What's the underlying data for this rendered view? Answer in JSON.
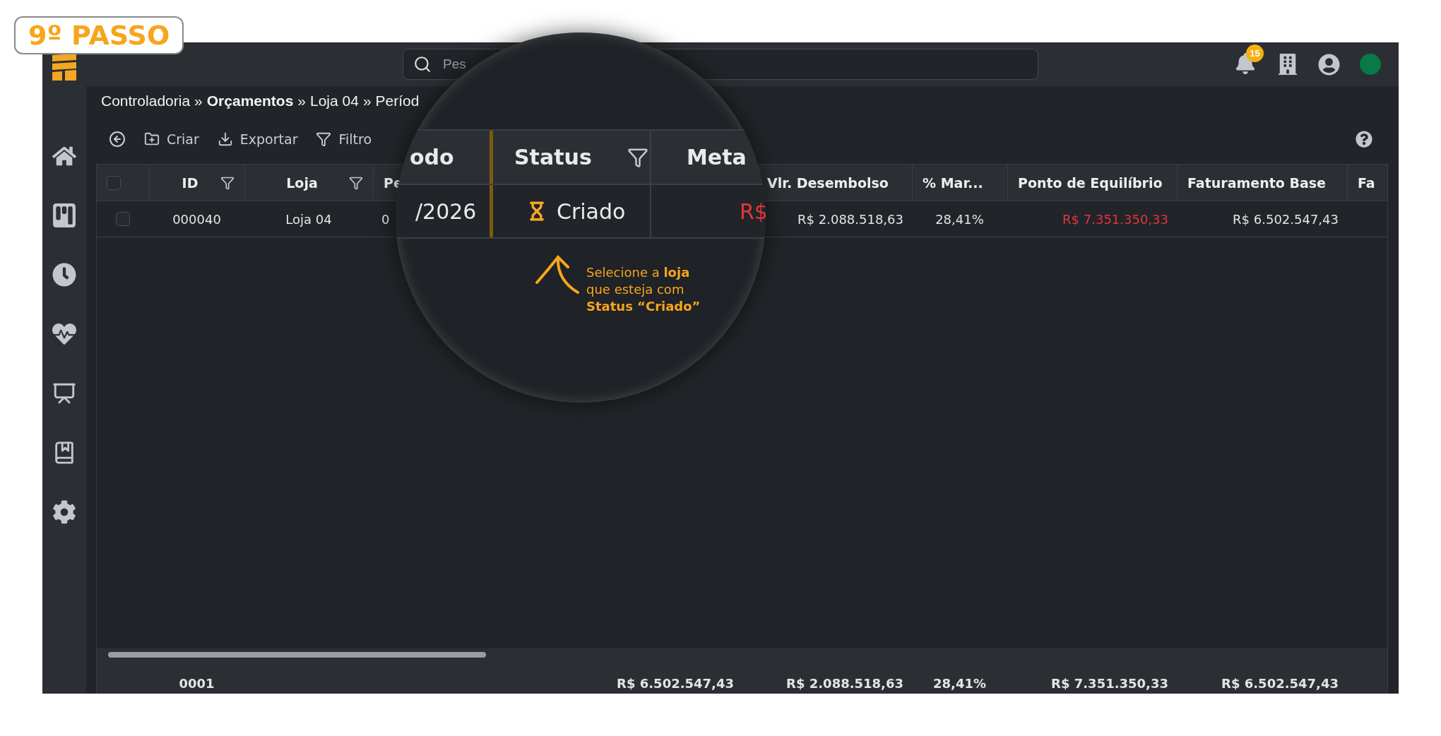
{
  "step_badge": "9º PASSO",
  "topbar": {
    "search": {
      "placeholder": "Pes"
    },
    "notifications": {
      "count": "15"
    }
  },
  "breadcrumb": {
    "separator": "»",
    "items": [
      {
        "label": "Controladoria",
        "bold": false
      },
      {
        "label": "Orçamentos",
        "bold": true
      },
      {
        "label": "Loja 04",
        "bold": false
      },
      {
        "label": "Períod",
        "bold": false
      }
    ]
  },
  "toolbar": {
    "buttons": [
      {
        "kind": "create",
        "label": "Criar"
      },
      {
        "kind": "export",
        "label": "Exportar"
      },
      {
        "kind": "filter",
        "label": "Filtro"
      }
    ]
  },
  "table": {
    "all_checked": false,
    "columns": [
      {
        "label": "ID",
        "kind": "id",
        "filter": true
      },
      {
        "label": "Loja",
        "kind": "text",
        "filter": true
      },
      {
        "label": "Pe",
        "kind": "date",
        "filter": false
      },
      {
        "label": "Vlr. Desembolso",
        "kind": "currency",
        "filter": false
      },
      {
        "label": "% Mar...",
        "kind": "percent",
        "filter": false
      },
      {
        "label": "Ponto de Equilíbrio",
        "kind": "currency",
        "filter": false
      },
      {
        "label": "Faturamento Base",
        "kind": "currency",
        "filter": false
      },
      {
        "label": "Fa",
        "filter": false
      }
    ],
    "rows": [
      {
        "checked": false,
        "cells": [
          {
            "text": "000040",
            "negative": false
          },
          {
            "text": "Loja 04",
            "negative": false
          },
          {
            "text": "0",
            "negative": false
          },
          {
            "text": "R$ 2.088.518,63",
            "negative": false
          },
          {
            "text": "28,41%",
            "negative": false
          },
          {
            "text": "R$ 7.351.350,33",
            "negative": true
          },
          {
            "text": "R$ 6.502.547,43",
            "negative": false
          }
        ]
      }
    ],
    "footer": [
      {
        "text": "0001",
        "kind": "id"
      },
      {
        "text": "R$ 6.502.547,43",
        "kind": "merged"
      },
      {
        "text": "R$ 2.088.518,63",
        "kind": "currency"
      },
      {
        "text": "28,41%",
        "kind": "percent"
      },
      {
        "text": "R$ 7.351.350,33",
        "kind": "currency"
      },
      {
        "text": "R$ 6.502.547,43",
        "kind": "currency"
      }
    ]
  },
  "magnifier": {
    "columns": [
      {
        "label": "odo",
        "highlighted": false
      },
      {
        "label": "Status",
        "filter": true,
        "highlighted": true
      },
      {
        "label": "Meta",
        "highlighted": false
      }
    ],
    "row": [
      {
        "kind": "text",
        "text": "/2026",
        "negative": false
      },
      {
        "kind": "status",
        "text": "Criado",
        "negative": false
      },
      {
        "kind": "text",
        "text": "R$",
        "negative": true
      }
    ],
    "callout": "Selecione a **loja**\nque esteja com\n**Status “Criado”**"
  }
}
